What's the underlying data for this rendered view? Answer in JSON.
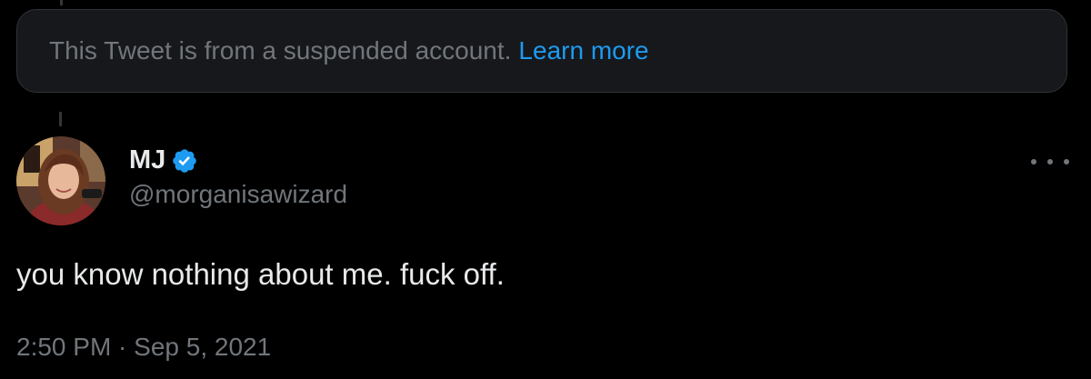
{
  "notice": {
    "text": "This Tweet is from a suspended account.",
    "link_label": "Learn more"
  },
  "author": {
    "name": "MJ",
    "handle": "@morganisawizard",
    "verified": true,
    "avatar_icon": "profile-photo"
  },
  "tweet": {
    "text": "you know nothing about me. fuck off.",
    "timestamp": "2:50 PM · Sep 5, 2021"
  },
  "actions": {
    "more_icon": "more-horizontal-icon"
  },
  "colors": {
    "background": "#000000",
    "card_background": "#16181c",
    "primary_text": "#e7e9ea",
    "secondary_text": "#71767b",
    "link": "#1d9bf0",
    "verified_badge": "#1d9bf0"
  }
}
